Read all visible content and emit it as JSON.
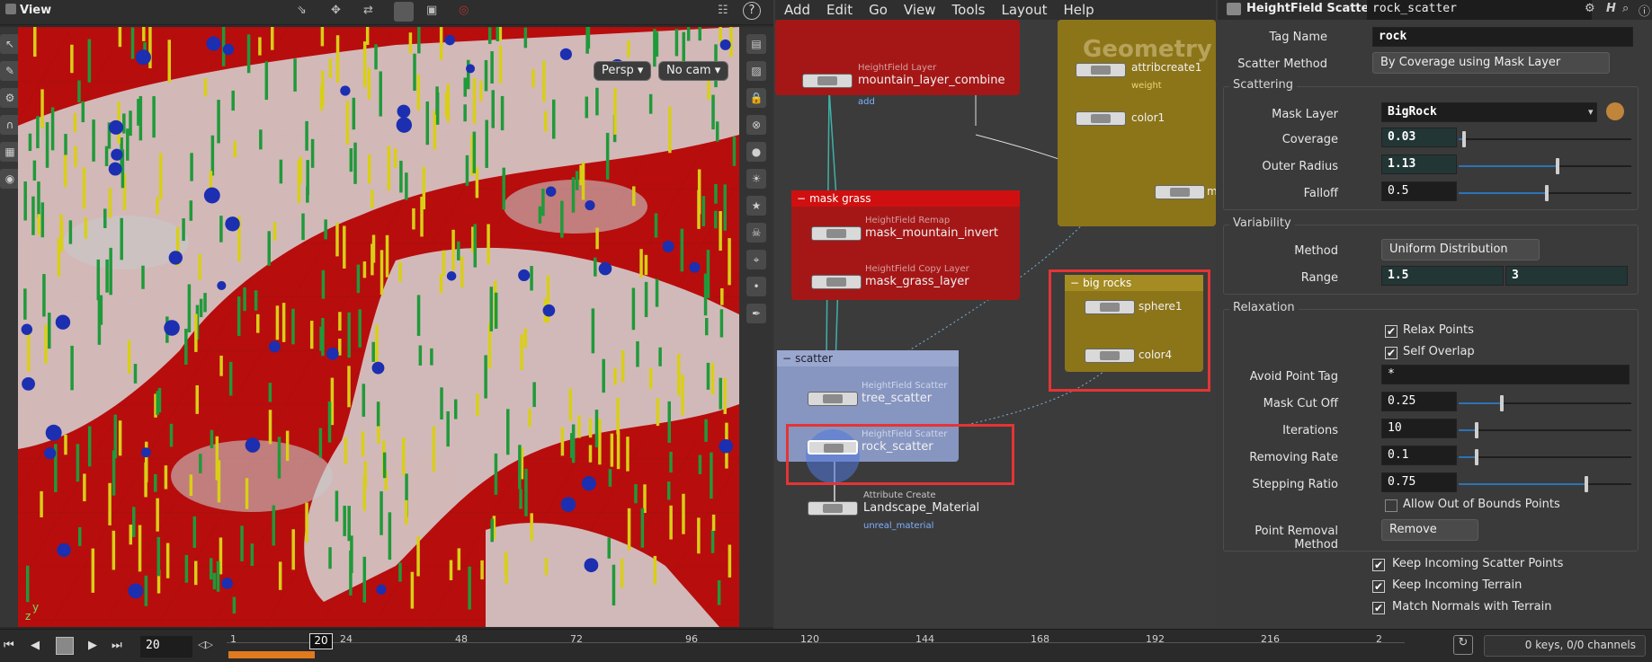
{
  "viewport": {
    "title": "View",
    "persp_button": "Persp ▾",
    "cam_button": "No cam ▾",
    "axis_labels": [
      "y",
      "z"
    ]
  },
  "network": {
    "menu": [
      "Add",
      "Edit",
      "Go",
      "View",
      "Tools",
      "Layout",
      "Help"
    ],
    "geometry_label": "Geometry",
    "boxes": {
      "mask_grass": "mask grass",
      "scatter": "scatter",
      "big_rocks": "big rocks"
    },
    "nodes": {
      "mountain": {
        "type": "HeightField Layer",
        "name": "mountain_layer_combine",
        "sub": "add"
      },
      "invert": {
        "type": "HeightField Remap",
        "name": "mask_mountain_invert"
      },
      "grass_layer": {
        "type": "HeightField Copy Layer",
        "name": "mask_grass_layer"
      },
      "tree_scatter": {
        "type": "HeightField Scatter",
        "name": "tree_scatter"
      },
      "rock_scatter": {
        "type": "HeightField Scatter",
        "name": "rock_scatter"
      },
      "landscape": {
        "type": "Attribute Create",
        "name": "Landscape_Material",
        "sub": "unreal_material"
      },
      "attribcreate": {
        "name": "attribcreate1",
        "sub": "weight"
      },
      "color1": {
        "name": "color1"
      },
      "sphere1": {
        "name": "sphere1"
      },
      "color4": {
        "name": "color4"
      },
      "merge_partial": "m"
    }
  },
  "params": {
    "node_type": "HeightField Scatter",
    "node_name": "rock_scatter",
    "tag_name_label": "Tag Name",
    "tag_name_value": "rock",
    "scatter_method_label": "Scatter Method",
    "scatter_method_value": "By Coverage using Mask Layer",
    "scattering_title": "Scattering",
    "mask_layer_label": "Mask Layer",
    "mask_layer_value": "BigRock",
    "coverage_label": "Coverage",
    "coverage_value": "0.03",
    "outer_radius_label": "Outer Radius",
    "outer_radius_value": "1.13",
    "falloff_label": "Falloff",
    "falloff_value": "0.5",
    "variability_title": "Variability",
    "method_label": "Method",
    "method_value": "Uniform Distribution",
    "range_label": "Range",
    "range_min": "1.5",
    "range_max": "3",
    "relaxation_title": "Relaxation",
    "relax_points": "Relax Points",
    "self_overlap": "Self Overlap",
    "avoid_tag_label": "Avoid Point Tag",
    "avoid_tag_value": "*",
    "mask_cutoff_label": "Mask Cut Off",
    "mask_cutoff_value": "0.25",
    "iterations_label": "Iterations",
    "iterations_value": "10",
    "removing_rate_label": "Removing Rate",
    "removing_rate_value": "0.1",
    "stepping_ratio_label": "Stepping Ratio",
    "stepping_ratio_value": "0.75",
    "allow_oob": "Allow Out of Bounds Points",
    "removal_method_label": "Point Removal Method",
    "removal_method_value": "Remove",
    "keep_scatter": "Keep Incoming Scatter Points",
    "keep_terrain": "Keep Incoming Terrain",
    "match_normals": "Match Normals with Terrain",
    "check_mark": "✔"
  },
  "timeline": {
    "current_frame": "20",
    "frame_field": "20",
    "ticks": [
      "1",
      "24",
      "48",
      "72",
      "96",
      "120",
      "144",
      "168",
      "192",
      "216",
      "2"
    ],
    "status": "0 keys, 0/0 channels"
  },
  "colors": {
    "terrain_red": "#b80d0d",
    "highlight_red": "#e53434",
    "accent_blue": "#2b73b6",
    "timeline_orange": "#e07a1f"
  }
}
